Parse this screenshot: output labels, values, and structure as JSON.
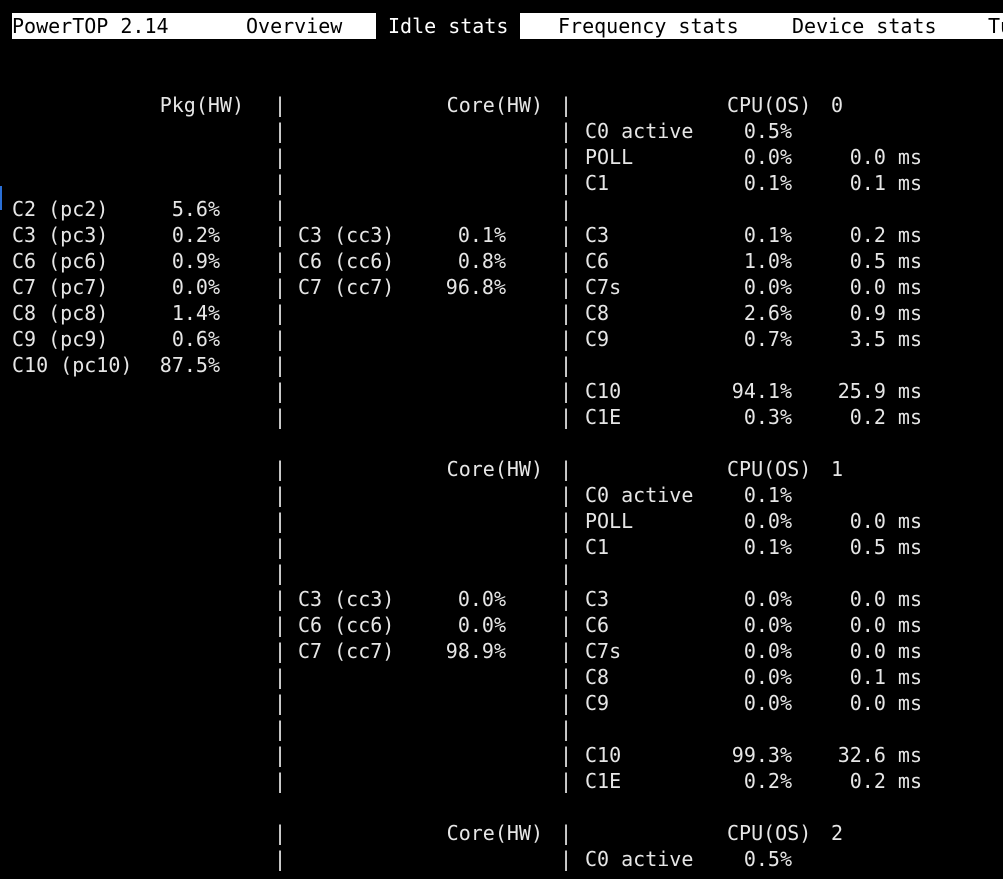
{
  "tabs": [
    {
      "label": "PowerTOP 2.14",
      "active": false
    },
    {
      "label": "Overview",
      "active": false
    },
    {
      "label": "Idle stats",
      "active": true
    },
    {
      "label": "Frequency stats",
      "active": false
    },
    {
      "label": "Device stats",
      "active": false
    },
    {
      "label": "Tu",
      "active": false
    }
  ],
  "separator": "|",
  "headers": {
    "pkg": "Pkg(HW)",
    "core": "Core(HW)",
    "cpu_prefix": "CPU(OS)"
  },
  "package_states": [
    {
      "name": "C2 (pc2)",
      "value": "5.6%"
    },
    {
      "name": "C3 (pc3)",
      "value": "0.2%"
    },
    {
      "name": "C6 (pc6)",
      "value": "0.9%"
    },
    {
      "name": "C7 (pc7)",
      "value": "0.0%"
    },
    {
      "name": "C8 (pc8)",
      "value": "1.4%"
    },
    {
      "name": "C9 (pc9)",
      "value": "0.6%"
    },
    {
      "name": "C10 (pc10)",
      "value": "87.5%"
    }
  ],
  "cpus": [
    {
      "cpu_id": "0",
      "core_states": [
        {
          "name": "C3 (cc3)",
          "value": "0.1%"
        },
        {
          "name": "C6 (cc6)",
          "value": "0.8%"
        },
        {
          "name": "C7 (cc7)",
          "value": "96.8%"
        }
      ],
      "cpu_states": [
        {
          "name": "C0 active",
          "pct": "0.5%",
          "time": ""
        },
        {
          "name": "POLL",
          "pct": "0.0%",
          "time": "0.0 ms"
        },
        {
          "name": "C1",
          "pct": "0.1%",
          "time": "0.1 ms"
        },
        {
          "name": "",
          "pct": "",
          "time": ""
        },
        {
          "name": "C3",
          "pct": "0.1%",
          "time": "0.2 ms"
        },
        {
          "name": "C6",
          "pct": "1.0%",
          "time": "0.5 ms"
        },
        {
          "name": "C7s",
          "pct": "0.0%",
          "time": "0.0 ms"
        },
        {
          "name": "C8",
          "pct": "2.6%",
          "time": "0.9 ms"
        },
        {
          "name": "C9",
          "pct": "0.7%",
          "time": "3.5 ms"
        },
        {
          "name": "",
          "pct": "",
          "time": ""
        },
        {
          "name": "C10",
          "pct": "94.1%",
          "time": "25.9 ms"
        },
        {
          "name": "C1E",
          "pct": "0.3%",
          "time": "0.2 ms"
        }
      ]
    },
    {
      "cpu_id": "1",
      "core_states": [
        {
          "name": "C3 (cc3)",
          "value": "0.0%"
        },
        {
          "name": "C6 (cc6)",
          "value": "0.0%"
        },
        {
          "name": "C7 (cc7)",
          "value": "98.9%"
        }
      ],
      "cpu_states": [
        {
          "name": "C0 active",
          "pct": "0.1%",
          "time": ""
        },
        {
          "name": "POLL",
          "pct": "0.0%",
          "time": "0.0 ms"
        },
        {
          "name": "C1",
          "pct": "0.1%",
          "time": "0.5 ms"
        },
        {
          "name": "",
          "pct": "",
          "time": ""
        },
        {
          "name": "C3",
          "pct": "0.0%",
          "time": "0.0 ms"
        },
        {
          "name": "C6",
          "pct": "0.0%",
          "time": "0.0 ms"
        },
        {
          "name": "C7s",
          "pct": "0.0%",
          "time": "0.0 ms"
        },
        {
          "name": "C8",
          "pct": "0.0%",
          "time": "0.1 ms"
        },
        {
          "name": "C9",
          "pct": "0.0%",
          "time": "0.0 ms"
        },
        {
          "name": "",
          "pct": "",
          "time": ""
        },
        {
          "name": "C10",
          "pct": "99.3%",
          "time": "32.6 ms"
        },
        {
          "name": "C1E",
          "pct": "0.2%",
          "time": "0.2 ms"
        }
      ]
    },
    {
      "cpu_id": "2",
      "core_states": [],
      "cpu_states": [
        {
          "name": "C0 active",
          "pct": "0.5%",
          "time": ""
        }
      ]
    }
  ]
}
